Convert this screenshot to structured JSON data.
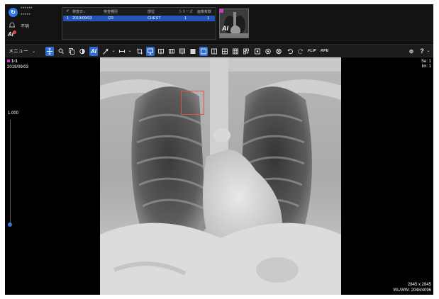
{
  "header": {
    "user_name": "******",
    "user_id": "*****",
    "status": "不明",
    "ai_label": "AI",
    "logo": "app-logo-icon"
  },
  "study_table": {
    "columns": [
      "#",
      "検査日 ↓",
      "検査種別",
      "部位",
      "シリーズ",
      "画像枚数"
    ],
    "rows": [
      {
        "index": "1",
        "date": "2019/09/03",
        "modality": "CR",
        "body_part": "CHEST",
        "series": "1",
        "images": "1"
      }
    ]
  },
  "thumbnail": {
    "ai_label": "AI"
  },
  "toolbar": {
    "menu_label": "メニュー",
    "items": [
      "move-icon",
      "zoom-icon",
      "copy-icon",
      "contrast-icon",
      "ai-icon",
      "arrow-icon",
      "ruler-icon",
      "crop-icon",
      "monitor-icon",
      "book-icon",
      "book-open-icon",
      "film-icon",
      "layout-1x1-icon",
      "layout-1x2-icon",
      "layout-2x2-icon",
      "layout-3x3-icon",
      "layout-grid-icon",
      "frame-icon",
      "link-icon",
      "stop-icon",
      "undo-icon",
      "redo-icon",
      "settings-icon",
      "help-icon"
    ],
    "flip_label": "FLIP",
    "rpe_label": "RPE",
    "help_label": "?"
  },
  "viewer": {
    "series_label": "1-1",
    "date": "2019/09/03",
    "se": "Se: 1",
    "im": "Im: 1",
    "zoom": "1.000",
    "zoom_level": 0.03,
    "size": "2845 x 2845",
    "wlww": "WL/WW: 2048/4096"
  },
  "colors": {
    "accent": "#2f6fd6",
    "marker": "#d92ed4",
    "roi": "#d9534f"
  }
}
